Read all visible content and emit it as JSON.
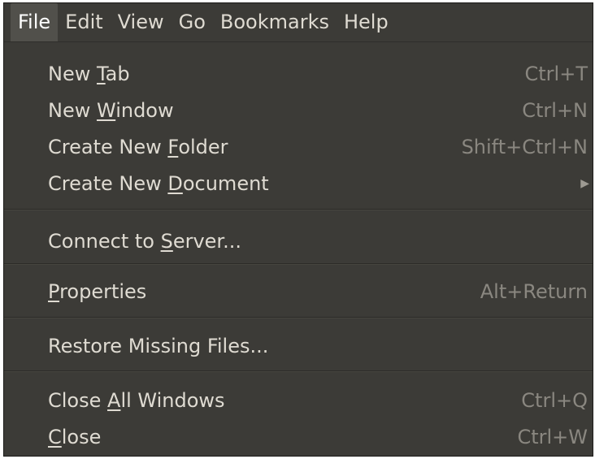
{
  "menubar": {
    "items": [
      {
        "label": "File"
      },
      {
        "label": "Edit"
      },
      {
        "label": "View"
      },
      {
        "label": "Go"
      },
      {
        "label": "Bookmarks"
      },
      {
        "label": "Help"
      }
    ]
  },
  "file_menu": {
    "items": [
      {
        "pre": "New ",
        "mnemonic": "T",
        "post": "ab",
        "shortcut": "Ctrl+T"
      },
      {
        "pre": "New ",
        "mnemonic": "W",
        "post": "indow",
        "shortcut": "Ctrl+N"
      },
      {
        "pre": "Create New ",
        "mnemonic": "F",
        "post": "older",
        "shortcut": "Shift+Ctrl+N"
      },
      {
        "pre": "Create New ",
        "mnemonic": "D",
        "post": "ocument",
        "submenu_arrow": "▶"
      },
      {
        "pre": "Connect to ",
        "mnemonic": "S",
        "post": "erver..."
      },
      {
        "pre": "",
        "mnemonic": "P",
        "post": "roperties",
        "shortcut": "Alt+Return"
      },
      {
        "pre": "Restore Missing Files...",
        "mnemonic": "",
        "post": ""
      },
      {
        "pre": "Close ",
        "mnemonic": "A",
        "post": "ll Windows",
        "shortcut": "Ctrl+Q"
      },
      {
        "pre": "",
        "mnemonic": "C",
        "post": "lose",
        "shortcut": "Ctrl+W"
      }
    ]
  },
  "colors": {
    "menu_bg": "#3c3b37",
    "text": "#dfdbd2",
    "shortcut_text": "#8a8780",
    "active_menubar_bg": "#51504b"
  }
}
